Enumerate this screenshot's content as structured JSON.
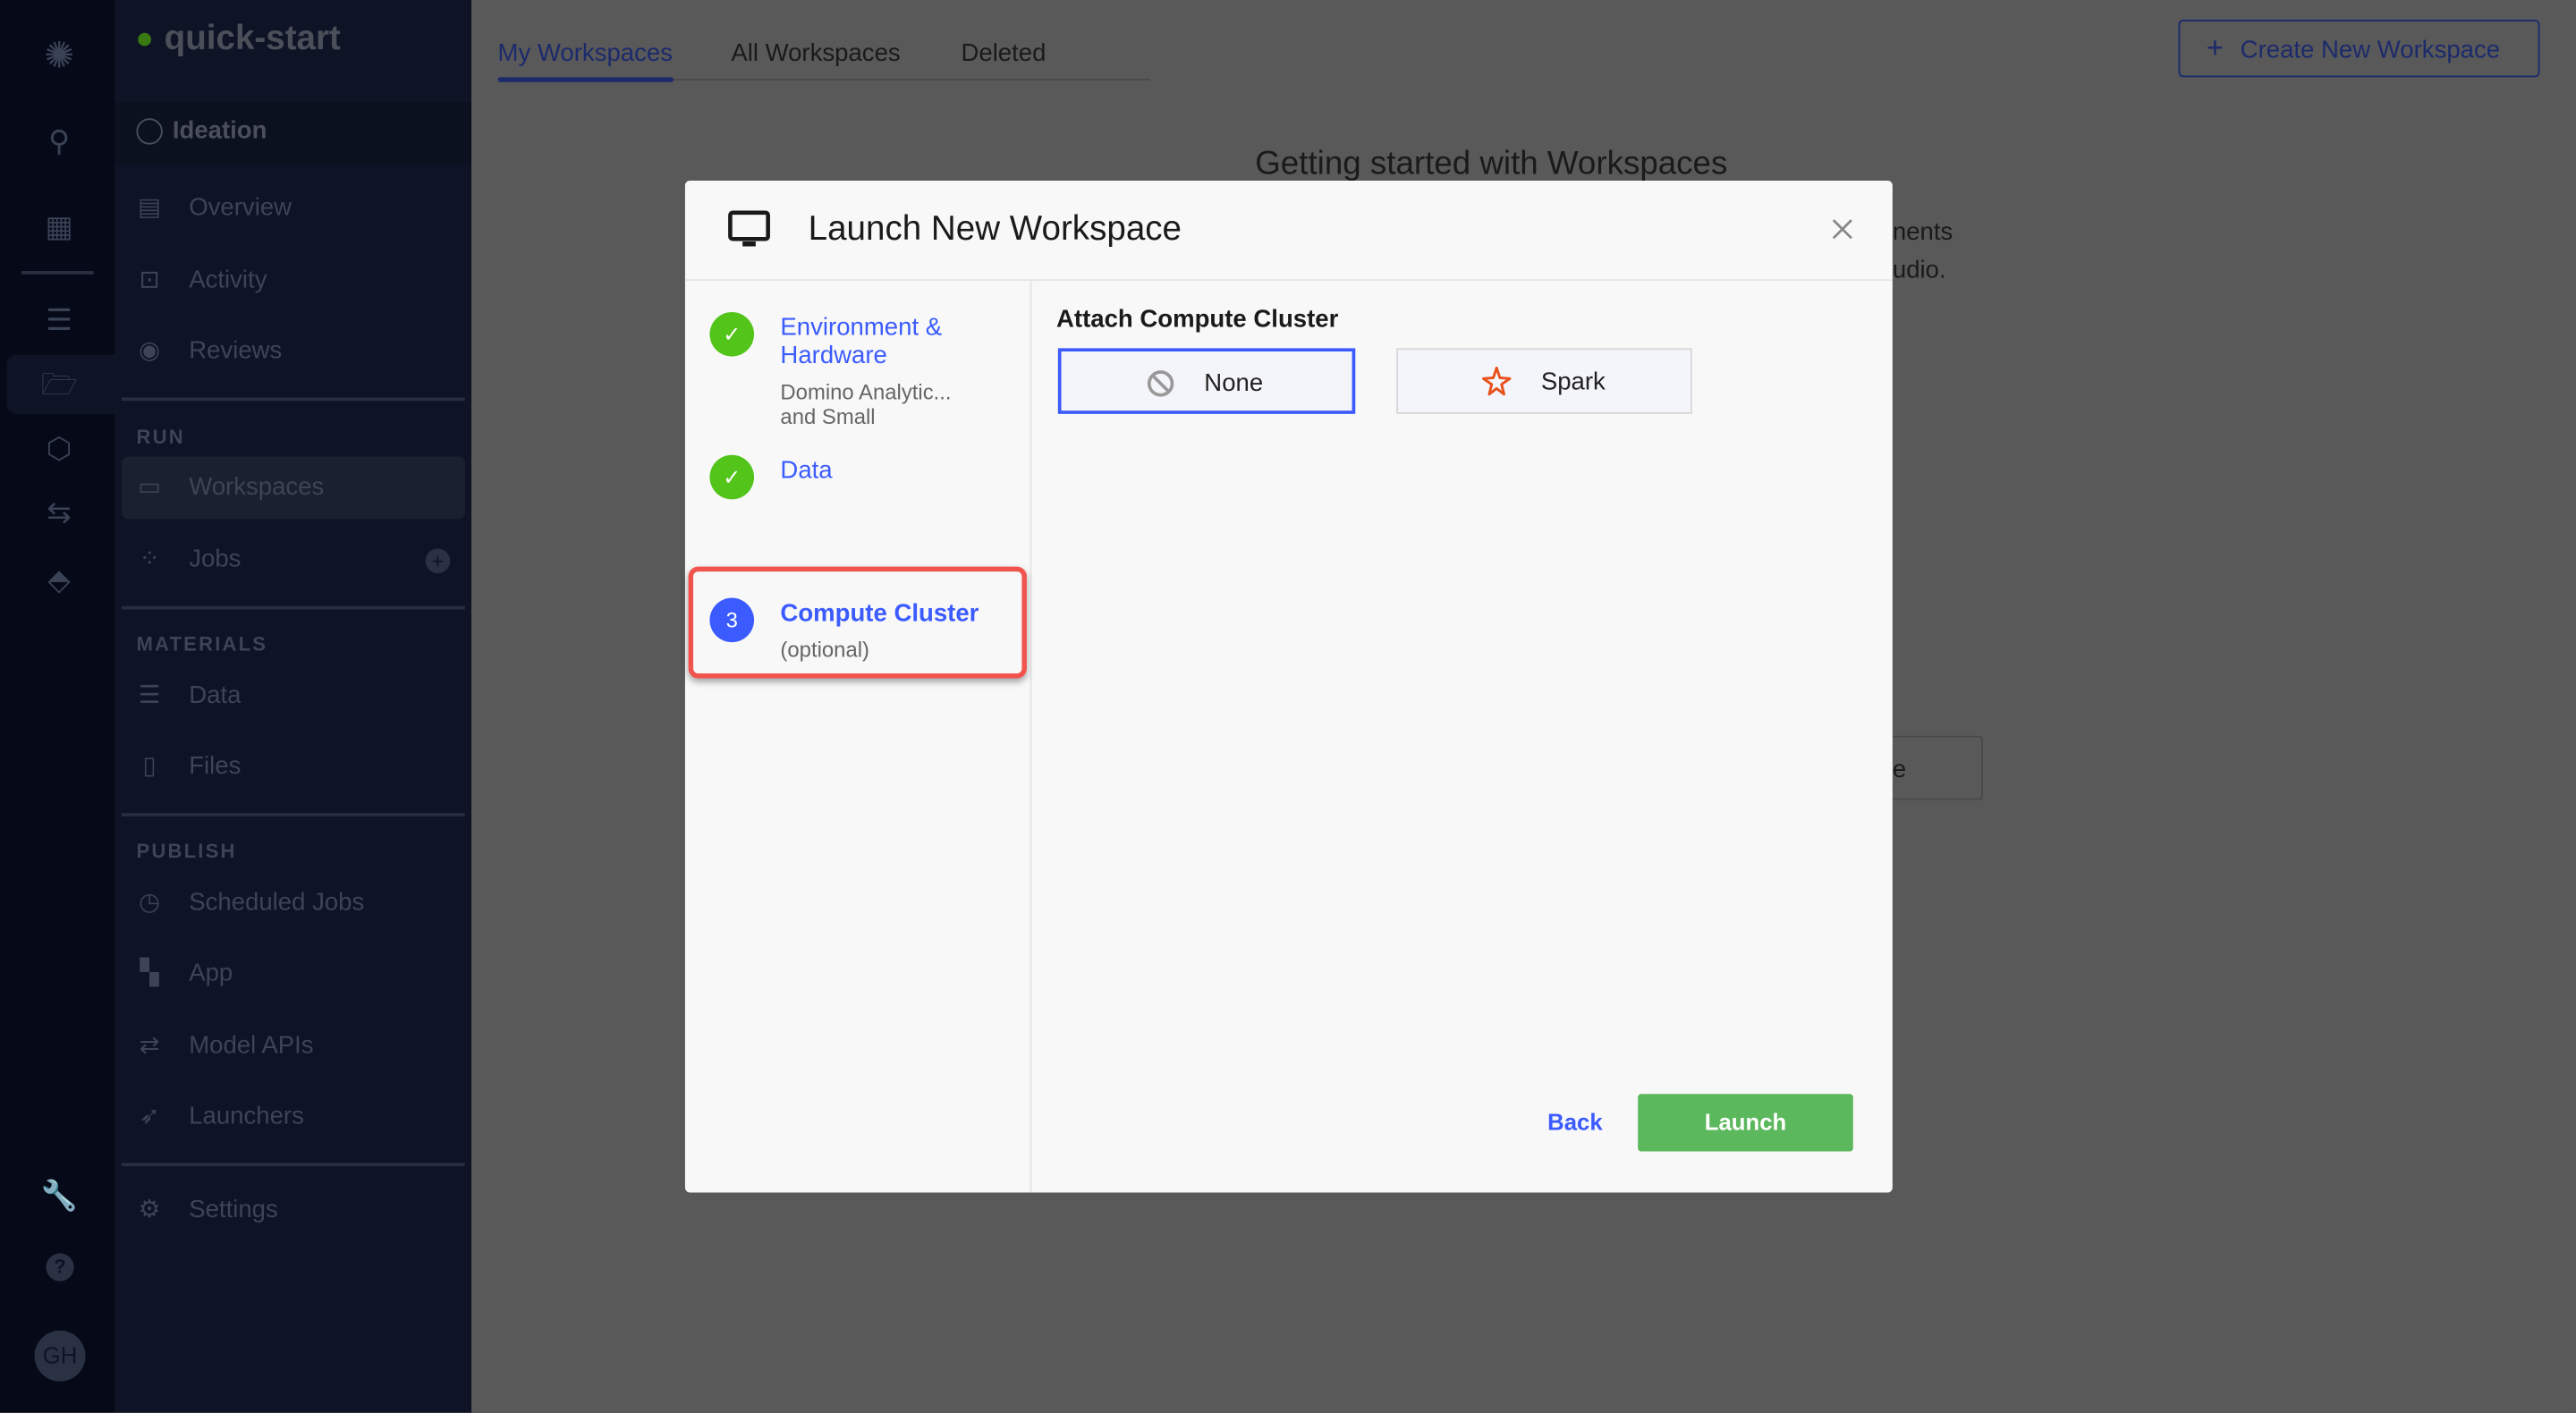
{
  "project": {
    "name": "quick-start",
    "status_color": "#3a7a12",
    "stage": "Ideation"
  },
  "rail": {
    "icons": [
      "domino-logo-icon",
      "search-icon",
      "apps-grid-icon",
      "database-icon",
      "folder-icon",
      "cube-icon",
      "transfer-arrows-icon",
      "tag-icon",
      "wrench-icon",
      "help-icon"
    ],
    "avatar_initials": "GH"
  },
  "sidebar": {
    "top_items": [
      {
        "label": "Overview",
        "icon": "overview-icon"
      },
      {
        "label": "Activity",
        "icon": "activity-icon"
      },
      {
        "label": "Reviews",
        "icon": "eye-icon"
      }
    ],
    "run_header": "RUN",
    "run_items": [
      {
        "label": "Workspaces",
        "icon": "monitor-icon",
        "active": true
      },
      {
        "label": "Jobs",
        "icon": "jobs-spinner-icon"
      }
    ],
    "materials_header": "MATERIALS",
    "materials_items": [
      {
        "label": "Data",
        "icon": "database-icon"
      },
      {
        "label": "Files",
        "icon": "file-icon"
      }
    ],
    "publish_header": "PUBLISH",
    "publish_items": [
      {
        "label": "Scheduled Jobs",
        "icon": "clock-icon"
      },
      {
        "label": "App",
        "icon": "app-icon"
      },
      {
        "label": "Model APIs",
        "icon": "transfer-arrows-icon"
      },
      {
        "label": "Launchers",
        "icon": "rocket-icon"
      }
    ],
    "settings": {
      "label": "Settings",
      "icon": "gear-icon"
    }
  },
  "main": {
    "tabs": [
      {
        "label": "My Workspaces",
        "active": true
      },
      {
        "label": "All Workspaces"
      },
      {
        "label": "Deleted"
      }
    ],
    "create_button": "Create New Workspace",
    "heading": "Getting started with Workspaces",
    "body_fragment_1": "nents",
    "body_fragment_2": "udio.",
    "button_fragment": "e"
  },
  "modal": {
    "title": "Launch New Workspace",
    "steps": [
      {
        "title_line1": "Environment &",
        "title_line2": "Hardware",
        "sub_line1": "Domino Analytic...",
        "sub_line2": "and Small",
        "status": "complete"
      },
      {
        "title_line1": "Data",
        "status": "complete"
      },
      {
        "number": "3",
        "title_line1": "Compute Cluster",
        "sub_line1": "(optional)",
        "status": "current",
        "highlighted": true
      }
    ],
    "section_title": "Attach Compute Cluster",
    "options": [
      {
        "label": "None",
        "icon": "ban-icon",
        "selected": true
      },
      {
        "label": "Spark",
        "icon": "spark-star-icon"
      }
    ],
    "back_label": "Back",
    "launch_label": "Launch"
  },
  "colors": {
    "accent": "#3b5bff",
    "success": "#5cb85c",
    "highlight": "#f0544c",
    "spark": "#e8501e"
  }
}
